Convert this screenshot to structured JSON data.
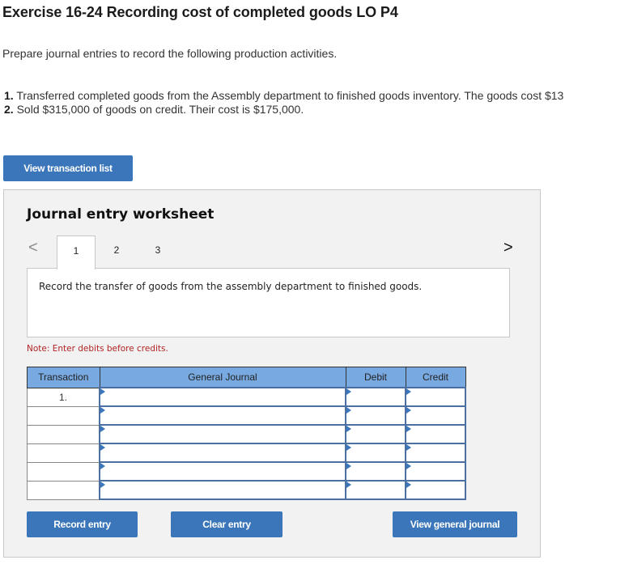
{
  "header": {
    "title": "Exercise 16-24 Recording cost of completed goods LO P4",
    "intro": "Prepare journal entries to record the following production activities."
  },
  "steps": [
    {
      "num": "1.",
      "text": "Transferred completed goods from the Assembly department to finished goods inventory. The goods cost $13"
    },
    {
      "num": "2.",
      "text": "Sold $315,000 of goods on credit. Their cost is $175,000."
    }
  ],
  "buttons": {
    "view_transaction_list": "View transaction list",
    "record_entry": "Record entry",
    "clear_entry": "Clear entry",
    "view_general_journal": "View general journal"
  },
  "worksheet": {
    "title": "Journal entry worksheet",
    "prev_icon": "<",
    "next_icon": ">",
    "tabs": [
      {
        "label": "1"
      },
      {
        "label": "2"
      },
      {
        "label": "3"
      }
    ],
    "active_tab": "1",
    "description": "Record the transfer of goods from the assembly department to finished goods.",
    "note": "Note: Enter debits before credits."
  },
  "journal": {
    "headers": {
      "transaction": "Transaction",
      "general_journal": "General Journal",
      "debit": "Debit",
      "credit": "Credit"
    },
    "rows": [
      {
        "transaction": "1.",
        "account": "",
        "debit": "",
        "credit": ""
      },
      {
        "transaction": "",
        "account": "",
        "debit": "",
        "credit": ""
      },
      {
        "transaction": "",
        "account": "",
        "debit": "",
        "credit": ""
      },
      {
        "transaction": "",
        "account": "",
        "debit": "",
        "credit": ""
      },
      {
        "transaction": "",
        "account": "",
        "debit": "",
        "credit": ""
      },
      {
        "transaction": "",
        "account": "",
        "debit": "",
        "credit": ""
      }
    ]
  }
}
